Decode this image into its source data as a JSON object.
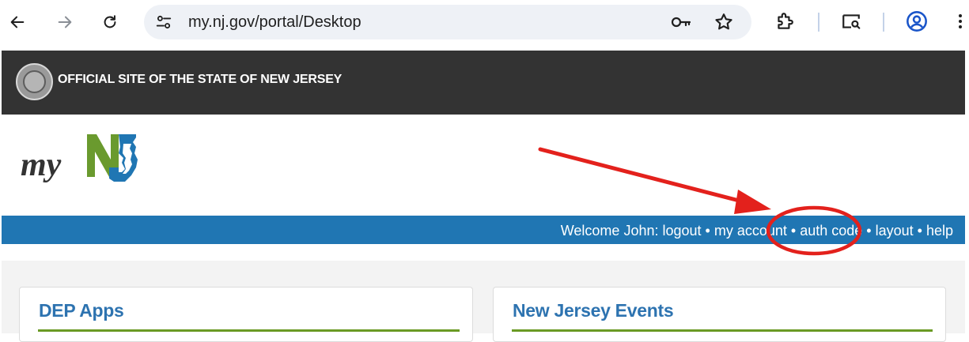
{
  "browser": {
    "url": "my.nj.gov/portal/Desktop",
    "icons": [
      "back-icon",
      "forward-icon",
      "reload-icon",
      "site-info-icon",
      "password-key-icon",
      "bookmark-star-icon",
      "extensions-icon",
      "tab-search-icon",
      "profile-icon",
      "menu-icon"
    ]
  },
  "official_bar": {
    "text": "OFFICIAL SITE OF THE STATE OF NEW JERSEY"
  },
  "logo": {
    "text": "my NJ",
    "colors": {
      "my": "#333333",
      "n": "#6a9a2e",
      "j": "#2076b3"
    }
  },
  "welcome_bar": {
    "greeting": "Welcome John:",
    "links": {
      "logout": "logout",
      "my_account": "my account",
      "auth_code": "auth code",
      "layout": "layout",
      "help": "help"
    },
    "separator": "•"
  },
  "cards": [
    {
      "title": "DEP Apps"
    },
    {
      "title": "New Jersey Events"
    }
  ],
  "colors": {
    "official_bar": "#333333",
    "welcome_bar": "#2076b3",
    "card_title": "#2d73b0",
    "card_rule": "#6a9a24",
    "annotation": "#e3211c"
  }
}
